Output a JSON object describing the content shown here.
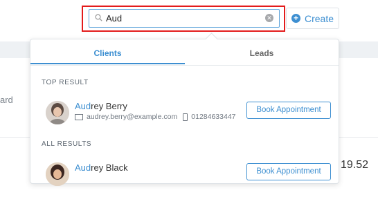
{
  "background": {
    "left_fragment": "ard",
    "right_fragment": "19.52"
  },
  "search": {
    "value": "Aud",
    "placeholder": ""
  },
  "toolbar": {
    "create_label": "Create"
  },
  "dropdown": {
    "tabs": [
      {
        "label": "Clients",
        "active": true
      },
      {
        "label": "Leads",
        "active": false
      }
    ],
    "top_result_title": "TOP RESULT",
    "all_results_title": "ALL RESULTS",
    "top_result": {
      "name_highlight": "Aud",
      "name_rest": "rey Berry",
      "email": "audrey.berry@example.com",
      "phone": "01284633447",
      "action_label": "Book Appointment"
    },
    "all_results": [
      {
        "name_highlight": "Aud",
        "name_rest": "rey Black",
        "action_label": "Book Appointment"
      }
    ]
  },
  "colors": {
    "accent": "#3d8fd1",
    "highlight_border": "#e31b1b"
  }
}
